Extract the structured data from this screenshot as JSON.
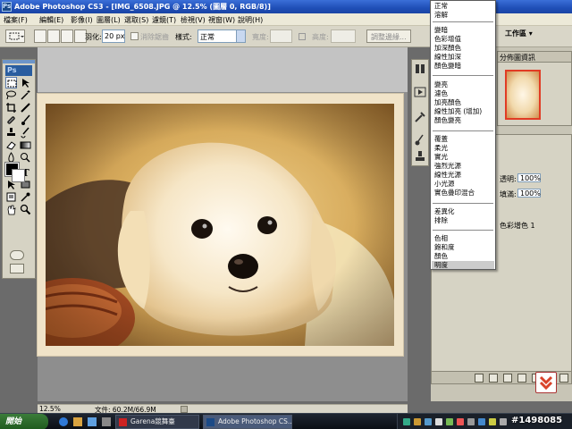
{
  "window": {
    "title": "Adobe Photoshop CS3 - [IMG_6508.JPG @ 12.5% (圖層 0, RGB/8)]"
  },
  "menu": [
    "檔案(F)",
    "編輯(E)",
    "影像(I)",
    "圖層(L)",
    "選取(S)",
    "濾鏡(T)",
    "檢視(V)",
    "視窗(W)",
    "說明(H)"
  ],
  "options": {
    "feather_label": "羽化:",
    "feather_value": "20 px",
    "antialias_label": "消除鋸齒",
    "style_label": "樣式:",
    "style_value": "正常",
    "width_label": "寬度:",
    "height_label": "高度:",
    "refine_edge": "調整邊緣...",
    "workspace": "工作區 ▾"
  },
  "toolbox": {
    "logo": "Ps"
  },
  "status": {
    "zoom": "12.5%",
    "doc_size": "文件: 60.2M/66.9M"
  },
  "navigator": {
    "tab_histogram": "分佈圖",
    "tab_info": "資訊"
  },
  "layers": {
    "opacity_label": "透明:",
    "opacity_value": "100%",
    "fill_label": "填滿:",
    "fill_value": "100%",
    "color_label": "色彩增色 1"
  },
  "blend_modes": {
    "groups": [
      [
        "正常",
        "溶解"
      ],
      [
        "變暗",
        "色彩增值",
        "加深顏色",
        "線性加深",
        "顏色變暗"
      ],
      [
        "變亮",
        "濾色",
        "加亮顏色",
        "線性加亮 (增加)",
        "顏色變亮"
      ],
      [
        "覆蓋",
        "柔光",
        "實光",
        "強烈光源",
        "線性光源",
        "小光源",
        "實色疊印混合"
      ],
      [
        "差異化",
        "排除"
      ],
      [
        "色相",
        "飽和度",
        "顏色",
        "明度"
      ]
    ],
    "highlighted": "明度"
  },
  "taskbar": {
    "start": "開始",
    "tasks": [
      {
        "label": "Garena競舞臺",
        "active": false
      },
      {
        "label": "Adobe Photoshop CS...",
        "active": true
      }
    ]
  },
  "watermark": "#1498085",
  "colors": {
    "accent_blue": "#1f4fb7",
    "menu_bg": "#ece9d8",
    "photo_warm": "#d7ab5c"
  }
}
